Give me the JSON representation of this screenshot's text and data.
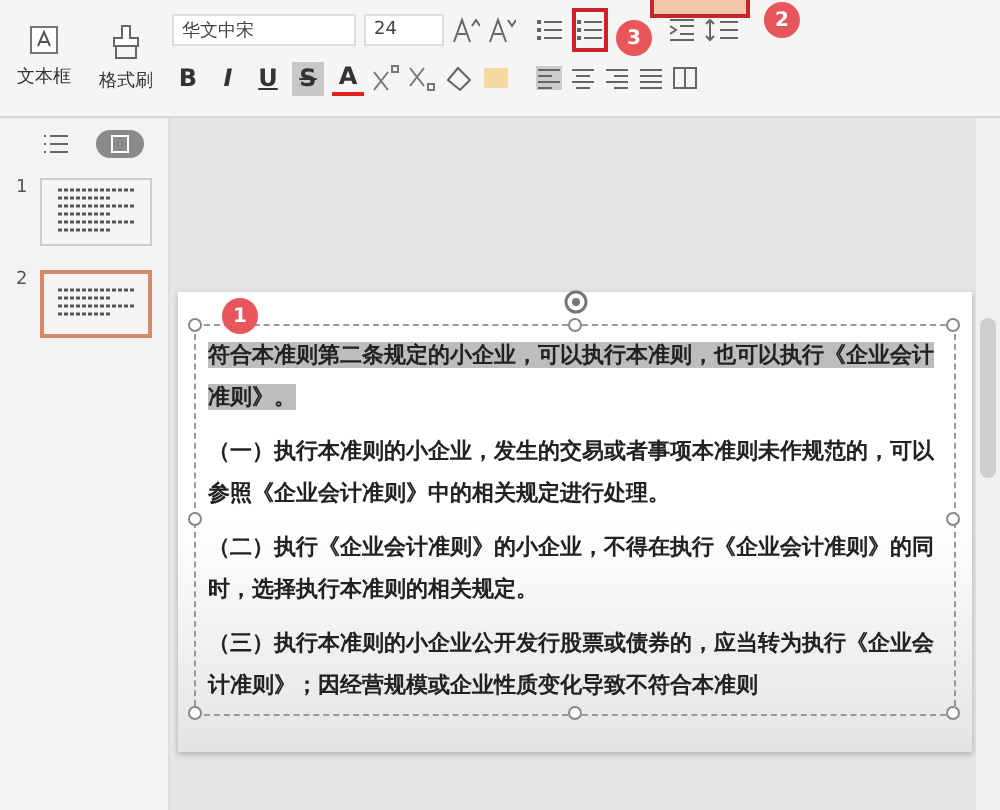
{
  "toolbar": {
    "insert_buttons": [
      {
        "label": "文本框",
        "kind": "textbox"
      },
      {
        "label": "格式刷",
        "kind": "painter"
      }
    ],
    "font_name": "华文中宋",
    "font_size": "24",
    "format_buttons": [
      {
        "label": "B",
        "kind": "bold",
        "selected": false
      },
      {
        "label": "I",
        "kind": "italic",
        "selected": false
      },
      {
        "label": "U",
        "kind": "underline",
        "selected": false
      },
      {
        "label": "S",
        "kind": "strike",
        "selected": true
      },
      {
        "label": "A",
        "kind": "color",
        "selected": false
      }
    ],
    "numbered_list": {
      "highlighted": true,
      "badge": "3"
    },
    "top_button": {
      "highlighted": true,
      "badge": "2"
    }
  },
  "slides_panel": {
    "slides": [
      {
        "number": "1",
        "selected": false
      },
      {
        "number": "2",
        "selected": true
      }
    ]
  },
  "slide": {
    "badge": "1",
    "paragraphs": [
      {
        "text": "符合本准则第二条规定的小企业，可以执行本准则，也可以执行《企业会计准则》。",
        "selected": true
      },
      {
        "text": "（一）执行本准则的小企业，发生的交易或者事项本准则未作规范的，可以参照《企业会计准则》中的相关规定进行处理。",
        "selected": false
      },
      {
        "text": "（二）执行《企业会计准则》的小企业，不得在执行《企业会计准则》的同时，选择执行本准则的相关规定。",
        "selected": false
      },
      {
        "text": "（三）执行本准则的小企业公开发行股票或债券的，应当转为执行《企业会计准则》；因经营规模或企业性质变化导致不符合本准则",
        "selected": false
      }
    ]
  }
}
